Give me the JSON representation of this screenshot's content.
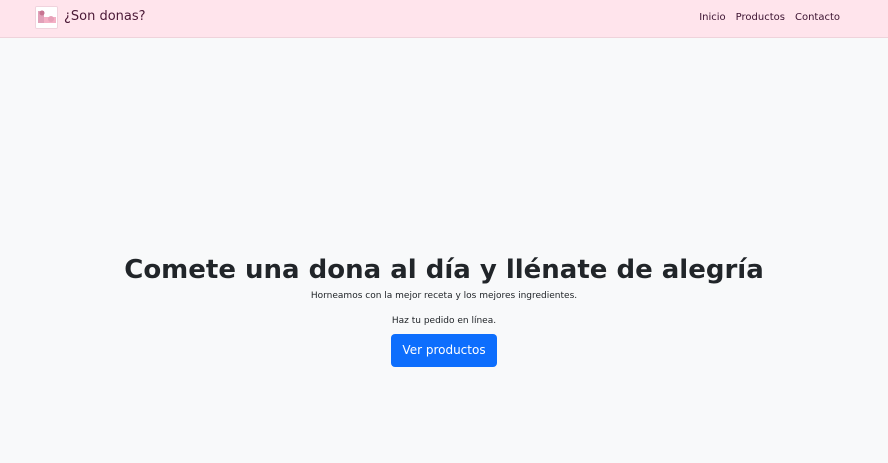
{
  "navbar": {
    "brand": {
      "logo_icon": "donut-logo-icon",
      "name": "¿Son donas?"
    },
    "links": [
      {
        "label": "Inicio"
      },
      {
        "label": "Productos"
      },
      {
        "label": "Contacto"
      }
    ],
    "background_color": "#ffe4ec"
  },
  "hero": {
    "title": "Comete una dona al día y llénate de alegría",
    "subtitle": "Horneamos con la mejor receta y los mejores ingredientes.",
    "order_text": "Haz tu pedido en línea.",
    "cta_label": "Ver productos",
    "cta_color": "#0d6efd"
  },
  "page": {
    "background_color": "#f8f9fa"
  }
}
